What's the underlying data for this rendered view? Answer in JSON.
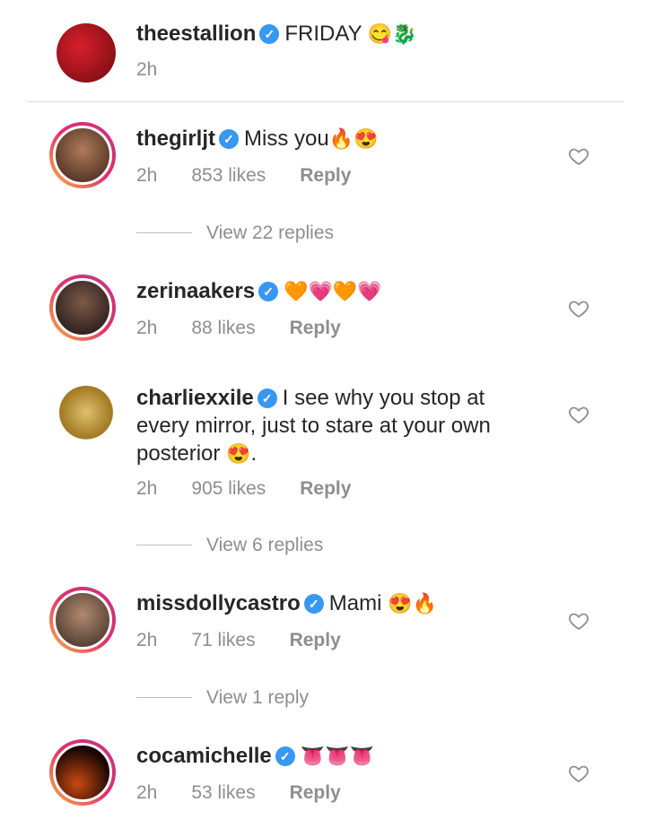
{
  "post": {
    "username": "theestallion",
    "caption": "FRIDAY",
    "emojis": "😋🐉",
    "time": "2h"
  },
  "comments": [
    {
      "username": "thegirljt",
      "text": "Miss you",
      "emojis": "🔥😍",
      "time": "2h",
      "likes": "853 likes",
      "reply": "Reply",
      "view_replies": "View 22 replies",
      "avatar_color": "#8a4a3a"
    },
    {
      "username": "zerinaakers",
      "text": "",
      "emojis": "🧡💗🧡💗",
      "time": "2h",
      "likes": "88 likes",
      "reply": "Reply",
      "view_replies": "",
      "avatar_color": "#2e2020"
    },
    {
      "username": "charliexxile",
      "text": "I see why you stop at every mirror, just to stare at your own posterior",
      "text_end": ".",
      "emojis": "😍",
      "time": "2h",
      "likes": "905 likes",
      "reply": "Reply",
      "view_replies": "View 6 replies",
      "avatar_color": "#c8a040"
    },
    {
      "username": "missdollycastro",
      "text": "Mami",
      "emojis": "😍🔥",
      "time": "2h",
      "likes": "71 likes",
      "reply": "Reply",
      "view_replies": "View 1 reply",
      "avatar_color": "#6b4a3a"
    },
    {
      "username": "cocamichelle",
      "text": "",
      "emojis": "👅👅👅",
      "time": "2h",
      "likes": "53 likes",
      "reply": "Reply",
      "view_replies": "",
      "avatar_color": "#3a1208"
    }
  ],
  "icons": {
    "like": "heart-outline-icon",
    "verified": "verified-badge-icon"
  },
  "colors": {
    "verified": "#3897f0",
    "muted": "#8e8e8e",
    "text": "#262626"
  }
}
